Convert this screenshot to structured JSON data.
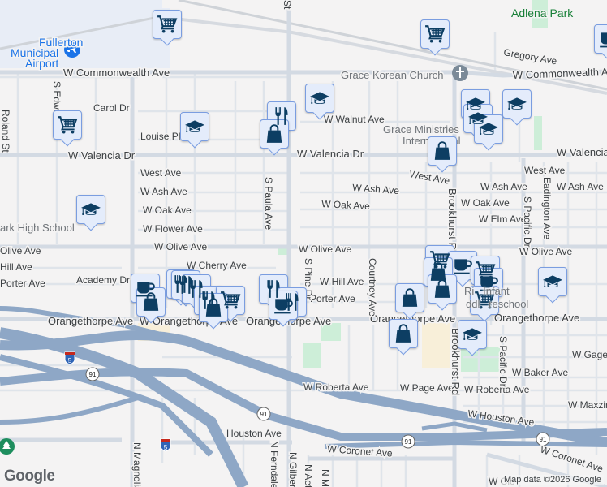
{
  "map": {
    "poi": {
      "airport": [
        "Fullerton",
        "Municipal",
        "Airport"
      ],
      "church": "Grace Korean Church",
      "ministries": [
        "Grace Ministries",
        "International"
      ],
      "park": "Adlena Park",
      "school": "ark High School",
      "preschool": [
        "Ri   Infant",
        "ddl   reschool"
      ]
    },
    "streets": {
      "commonwealth": "W Commonwealth Ave",
      "commonwealth_r": "W Commonwealth Ave",
      "gregory": "Gregory Ave",
      "carol": "Carol Dr",
      "louise": "Louise Pl",
      "walnut": "W Walnut Ave",
      "valencia1": "W Valencia Dr",
      "valencia2": "W Valencia Dr",
      "valencia3": "W Valencia Dr",
      "west1": "West Ave",
      "west2": "West Ave",
      "west3": "West Ave",
      "ash1": "W Ash Ave",
      "ash2": "W Ash Ave",
      "ash3": "W Ash Ave",
      "ash4": "W Ash Ave",
      "oak1": "W Oak Ave",
      "oak2": "W Oak Ave",
      "oak3": "W Oak Ave",
      "elm": "W Elm Ave",
      "flower": "W Flower Ave",
      "olive0": "Olive Ave",
      "olive1": "W Olive Ave",
      "olive2": "W Olive Ave",
      "olive3": "W Olive Ave",
      "cherry": "W Cherry Ave",
      "academy": "Academy Dr",
      "hill0": "Hill Ave",
      "hill1": "W Hill Ave",
      "porter0": "Porter Ave",
      "porter1": "Porter Ave",
      "orange1": "Orangethorpe Ave",
      "orange2": "W Orangethorpe Ave",
      "orange3": "Orangethorpe Ave",
      "orange4": "Orangethorpe Ave",
      "orange5": "Orangethorpe Ave",
      "roberta1": "W Roberta Ave",
      "roberta2": "W Roberta Ave",
      "page": "W Page Ave",
      "baker": "W Baker Ave",
      "gage": "W Gage Ave",
      "maxzim": "W Maxzim",
      "whouston": "W Houston Ave",
      "houston": "Houston Ave",
      "coronet1": "W Coronet Ave",
      "coronet2": "W Coronet Ave",
      "clo": "W Clo",
      "magnolia": "N Magnolia",
      "ferndale": "N Ferndale",
      "gilbert": "N Gilbert",
      "paula": "S Paula Ave",
      "pine": "S Pine Dr",
      "courtney": "Courtney Ave",
      "brookhurst1": "Brookhurst Rd",
      "brookhurst2": "Brookhurst Rd",
      "pacific1": "S Pacific Dr",
      "pacific2": "S Pacific Dr",
      "eadington": "Eadington Ave",
      "edwards": "S Edwa",
      "roland": "Roland St",
      "st": "St",
      "aet": "N Aet",
      "mo": "N Mo"
    },
    "shields": {
      "i5": "5",
      "sr91": "91"
    },
    "attribution": "Map data ©2026 Google",
    "logo": "Google"
  }
}
